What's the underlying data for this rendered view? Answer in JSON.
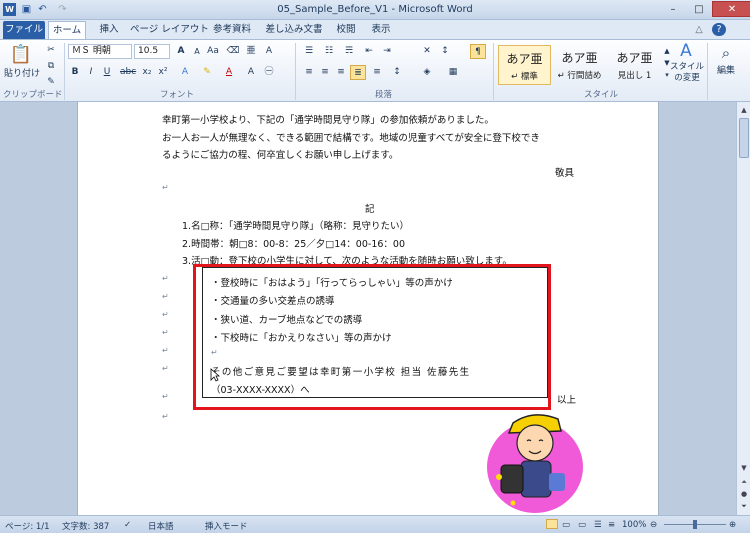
{
  "window": {
    "title": "05_Sample_Before_V1 - Microsoft Word",
    "controls": {
      "minimize": "–",
      "maximize": "□",
      "close": "✕"
    }
  },
  "quick_access": [
    "word-logo-icon",
    "save-icon",
    "undo-icon",
    "redo-icon"
  ],
  "tabs": [
    {
      "label": "ファイル"
    },
    {
      "label": "ホーム"
    },
    {
      "label": "挿入"
    },
    {
      "label": "ページ レイアウト"
    },
    {
      "label": "参考資料"
    },
    {
      "label": "差し込み文書"
    },
    {
      "label": "校閲"
    },
    {
      "label": "表示"
    }
  ],
  "ribbon": {
    "clipboard": {
      "paste_label": "貼り付け",
      "group_label": "クリップボード"
    },
    "font": {
      "name": "ＭＳ 明朝",
      "size": "10.5",
      "group_label": "フォント"
    },
    "paragraph": {
      "group_label": "段落"
    },
    "styles": {
      "items": [
        {
          "sample": "あア亜",
          "name": "↵ 標準"
        },
        {
          "sample": "あア亜",
          "name": "↵ 行間詰め"
        },
        {
          "sample": "あア亜",
          "name": "見出し 1"
        }
      ],
      "change_label": "スタイルの変更",
      "group_label": "スタイル"
    },
    "edit_label": "編集"
  },
  "document": {
    "lines": [
      "幸町第一小学校より、下記の「通学時間見守り隊」の参加依頼がありました。",
      "お一人お一人が無理なく、できる範囲で結構です。地域の児童すべてが安全に登下校でき",
      "るようにご協力の程、何卒宜しくお願い申し上げます。",
      "敬具",
      "記",
      "1.名□称：「通学時間見守り隊」（略称：見守りたい）",
      "2.時間帯：朝□8：00-8：25／夕□14：00-16：00",
      "3.活□動：登下校の小学生に対して、次のような活動を随時お願い致します。"
    ],
    "box_lines": [
      "・登校時に「おはよう」「行ってらっしゃい」等の声かけ",
      "・交通量の多い交差点の誘導",
      "・狭い道、カーブ地点などでの誘導",
      "・下校時に「おかえりなさい」等の声かけ",
      "",
      "その他ご意見ご要望は幸町第一小学校 担当 佐藤先生",
      "（03-XXXX-XXXX）へ"
    ],
    "closing": "以上",
    "paragraph_mark": "↵"
  },
  "status": {
    "page": "ページ: 1/1",
    "words": "文字数: 387",
    "language": "日本語",
    "mode": "挿入モード",
    "zoom": "100%"
  },
  "colors": {
    "accent": "#2a5fa8",
    "highlight": "#e2141c"
  }
}
